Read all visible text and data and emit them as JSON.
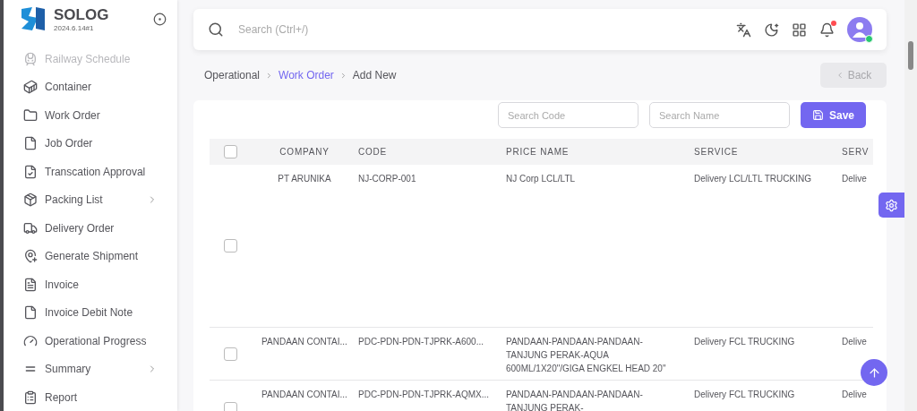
{
  "brand": {
    "name": "SOLOG",
    "version": "2024.6.14#1"
  },
  "sidebar": {
    "items": [
      {
        "label": "Railway Schedule",
        "faded": true,
        "expandable": false
      },
      {
        "label": "Container",
        "faded": false,
        "expandable": false
      },
      {
        "label": "Work Order",
        "faded": false,
        "expandable": false
      },
      {
        "label": "Job Order",
        "faded": false,
        "expandable": false
      },
      {
        "label": "Transcation Approval",
        "faded": false,
        "expandable": false
      },
      {
        "label": "Packing List",
        "faded": false,
        "expandable": true
      },
      {
        "label": "Delivery Order",
        "faded": false,
        "expandable": false
      },
      {
        "label": "Generate Shipment",
        "faded": false,
        "expandable": false
      },
      {
        "label": "Invoice",
        "faded": false,
        "expandable": false
      },
      {
        "label": "Invoice Debit Note",
        "faded": false,
        "expandable": false
      },
      {
        "label": "Operational Progress",
        "faded": false,
        "expandable": false
      },
      {
        "label": "Summary",
        "faded": false,
        "expandable": true
      },
      {
        "label": "Report",
        "faded": false,
        "expandable": false
      }
    ]
  },
  "search": {
    "placeholder": "Search (Ctrl+/)"
  },
  "breadcrumb": [
    {
      "label": "Operational",
      "link": false
    },
    {
      "label": "Work Order",
      "link": true
    },
    {
      "label": "Add New",
      "link": false
    }
  ],
  "back_button": {
    "label": "Back",
    "disabled": true
  },
  "filters": [
    {
      "placeholder": "Search Code"
    },
    {
      "placeholder": "Search Name"
    }
  ],
  "save_button": {
    "label": "Save"
  },
  "table": {
    "select_all_checked": false,
    "columns": [
      "COMPANY",
      "CODE",
      "PRICE NAME",
      "SERVICE",
      "SERV"
    ],
    "rows": [
      {
        "checked": false,
        "cells": [
          "PT ARUNIKA",
          "NJ-CORP-001",
          "NJ Corp LCL/LTL",
          "Delivery LCL/LTL TRUCKING",
          "Delive"
        ]
      },
      {
        "checked": false,
        "cells": [
          "PANDAAN CONTAI...",
          "PDC-PDN-PDN-TJPRK-A600...",
          "PANDAAN-PANDAAN-PANDAAN-TANJUNG PERAK-AQUA 600ML/1X20\"/GIGA ENGKEL HEAD 20\"",
          "Delivery FCL TRUCKING",
          "Delive"
        ]
      },
      {
        "checked": false,
        "cells": [
          "PANDAAN CONTAI...",
          "PDC-PDN-PDN-TJPRK-AQMX...",
          "PANDAAN-PANDAAN-PANDAAN-TANJUNG PERAK-",
          "Delivery FCL TRUCKING",
          "Delive"
        ]
      }
    ]
  }
}
